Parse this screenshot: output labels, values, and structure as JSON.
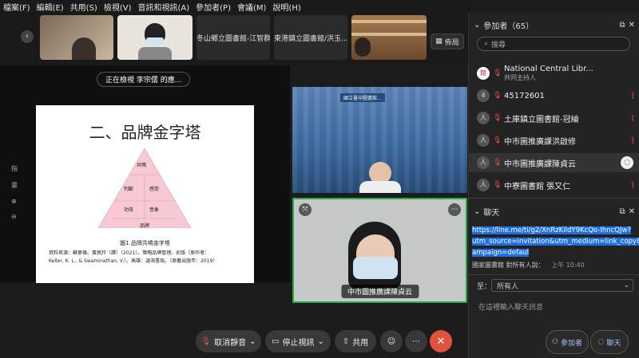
{
  "menu": [
    "檔案(F)",
    "編輯(E)",
    "共用(S)",
    "檢視(V)",
    "音訊和視訊(A)",
    "參加者(P)",
    "會議(M)",
    "說明(H)"
  ],
  "strip": {
    "thumbs": [
      "",
      "",
      "冬山鄉立圖書館-江智群",
      "東港鎮立圖書館/洪玉...",
      ""
    ],
    "layout_label": "佈局"
  },
  "share": {
    "viewing": "正在檢視 李宗儒 的應...",
    "slide_title": "二、品牌金字塔",
    "pyramid_top": "共鳴",
    "pyramid_mid_left": "判斷",
    "pyramid_mid_right": "感受",
    "pyramid_low_left": "功效",
    "pyramid_low_right": "意象",
    "pyramid_base": "品牌",
    "caption": "圖1 品牌共鳴金字塔",
    "source_line1": "資料來源：蘇麥倫、黃佩玲（譯）（2021）。策略品牌管理。初版（原作者：",
    "source_line2": "Keller, K. L., & Swaminathan, V.）。高雄：滄海書局。（原著出版年：2019）",
    "side_tools": [
      "指",
      "畫",
      "⊕",
      "⊖"
    ]
  },
  "videos": {
    "v1_banner": "國立臺中圖書館...",
    "v2_name": "中市圖推廣課陳貞云"
  },
  "toolbar": {
    "unmute": "取消靜音",
    "stop_video": "停止視訊",
    "share": "共用"
  },
  "panel": {
    "participants_title": "參加者（65）",
    "search_placeholder": "搜尋",
    "participants": [
      {
        "avatar": "館",
        "name": "National Central Libr...",
        "sub": "共同主持人"
      },
      {
        "avatar": "4",
        "name": "45172601",
        "sub": ""
      },
      {
        "avatar": "人",
        "name": "土庫鎮立圖書館-冠綸",
        "sub": ""
      },
      {
        "avatar": "人",
        "name": "中市圖推廣課洪啟修",
        "sub": ""
      },
      {
        "avatar": "人",
        "name": "中市圖推廣課陳貞云",
        "sub": ""
      },
      {
        "avatar": "人",
        "name": "中寮圖書館 張又仁",
        "sub": ""
      }
    ],
    "chat_title": "聊天",
    "chat_link_lines": [
      "https://line.me/ti/g2/XnRzKildY9KcQo-IhncQJw?",
      "utm_source=invitation&utm_medium=link_copy&utm_c",
      "ampaign=defaul"
    ],
    "chat_sender": "國家圖書館 對所有人說：",
    "chat_time": "上午 10:40",
    "to_label": "至：",
    "to_value": "所有人",
    "input_placeholder": "在這裡輸入聊天訊息",
    "btn_participants": "參加者",
    "btn_chat": "聊天"
  },
  "colors": {
    "accent_red": "#e0533d",
    "link_blue": "#1f6fe0",
    "pyramid_pink": "#f6c9d3",
    "active_border": "#28a745"
  }
}
